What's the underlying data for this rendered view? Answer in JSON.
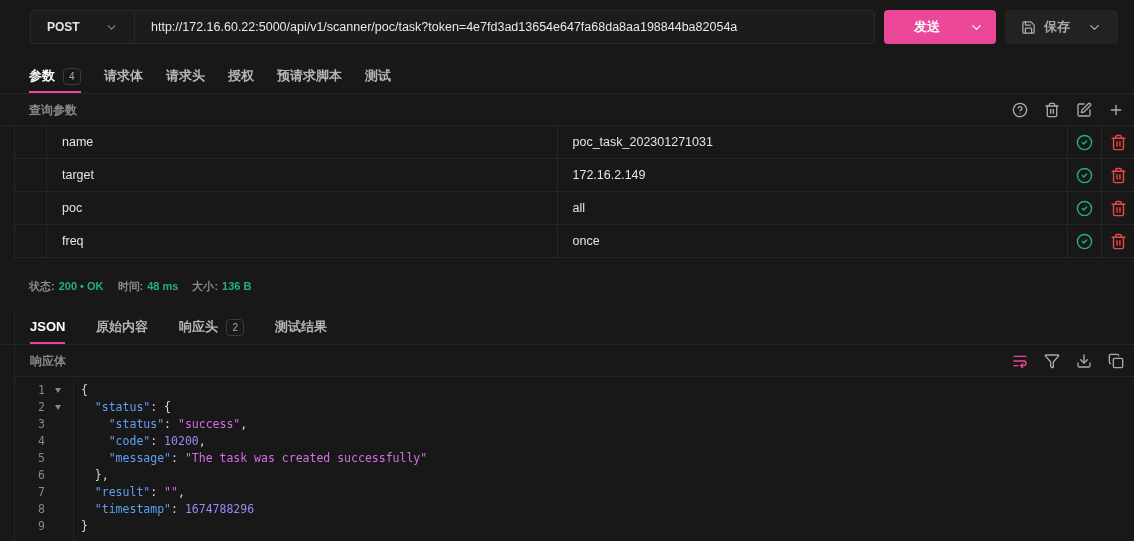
{
  "request": {
    "method": "POST",
    "url": "http://172.16.60.22:5000/api/v1/scanner/poc/task?token=4e7fd3ad13654e647fa68da8aa198844ba82054a",
    "send_label": "发送",
    "save_label": "保存"
  },
  "request_tabs": [
    {
      "label": "参数",
      "badge": "4",
      "selected": true
    },
    {
      "label": "请求体",
      "selected": false
    },
    {
      "label": "请求头",
      "selected": false
    },
    {
      "label": "授权",
      "selected": false
    },
    {
      "label": "预请求脚本",
      "selected": false
    },
    {
      "label": "测试",
      "selected": false
    }
  ],
  "params": {
    "title": "查询参数",
    "rows": [
      {
        "key": "name",
        "value": "poc_task_202301271031",
        "enabled": true
      },
      {
        "key": "target",
        "value": "172.16.2.149",
        "enabled": true
      },
      {
        "key": "poc",
        "value": "all",
        "enabled": true
      },
      {
        "key": "freq",
        "value": "once",
        "enabled": true
      }
    ]
  },
  "status_bar": [
    {
      "label": "状态:",
      "value": "200 • OK"
    },
    {
      "label": "时间:",
      "value": "48 ms"
    },
    {
      "label": "大小:",
      "value": "136 B"
    }
  ],
  "response_tabs": [
    {
      "label": "JSON",
      "selected": true
    },
    {
      "label": "原始内容",
      "selected": false
    },
    {
      "label": "响应头",
      "badge": "2",
      "selected": false
    },
    {
      "label": "测试结果",
      "selected": false
    }
  ],
  "response": {
    "title": "响应体",
    "wrap_on": true,
    "lines": [
      {
        "number": "1",
        "foldable": true,
        "tokens": [
          {
            "kind": "punct",
            "text": "{"
          }
        ]
      },
      {
        "number": "2",
        "foldable": true,
        "tokens": [
          {
            "kind": "key",
            "text": "  \"status\""
          },
          {
            "kind": "punct",
            "text": ": {"
          }
        ]
      },
      {
        "number": "3",
        "foldable": false,
        "tokens": [
          {
            "kind": "key",
            "text": "    \"status\""
          },
          {
            "kind": "punct",
            "text": ": "
          },
          {
            "kind": "string",
            "text": "\"success\""
          },
          {
            "kind": "punct",
            "text": ","
          }
        ]
      },
      {
        "number": "4",
        "foldable": false,
        "tokens": [
          {
            "kind": "key",
            "text": "    \"code\""
          },
          {
            "kind": "punct",
            "text": ": "
          },
          {
            "kind": "number",
            "text": "10200"
          },
          {
            "kind": "punct",
            "text": ","
          }
        ]
      },
      {
        "number": "5",
        "foldable": false,
        "tokens": [
          {
            "kind": "key",
            "text": "    \"message\""
          },
          {
            "kind": "punct",
            "text": ": "
          },
          {
            "kind": "string",
            "text": "\"The task was created successfully\""
          }
        ]
      },
      {
        "number": "6",
        "foldable": false,
        "tokens": [
          {
            "kind": "punct",
            "text": "  },"
          }
        ]
      },
      {
        "number": "7",
        "foldable": false,
        "tokens": [
          {
            "kind": "key",
            "text": "  \"result\""
          },
          {
            "kind": "punct",
            "text": ": "
          },
          {
            "kind": "string",
            "text": "\"\""
          },
          {
            "kind": "punct",
            "text": ","
          }
        ]
      },
      {
        "number": "8",
        "foldable": false,
        "tokens": [
          {
            "kind": "key",
            "text": "  \"timestamp\""
          },
          {
            "kind": "punct",
            "text": ": "
          },
          {
            "kind": "number",
            "text": "1674788296"
          }
        ]
      },
      {
        "number": "9",
        "foldable": false,
        "tokens": [
          {
            "kind": "punct",
            "text": "}"
          }
        ]
      }
    ]
  }
}
